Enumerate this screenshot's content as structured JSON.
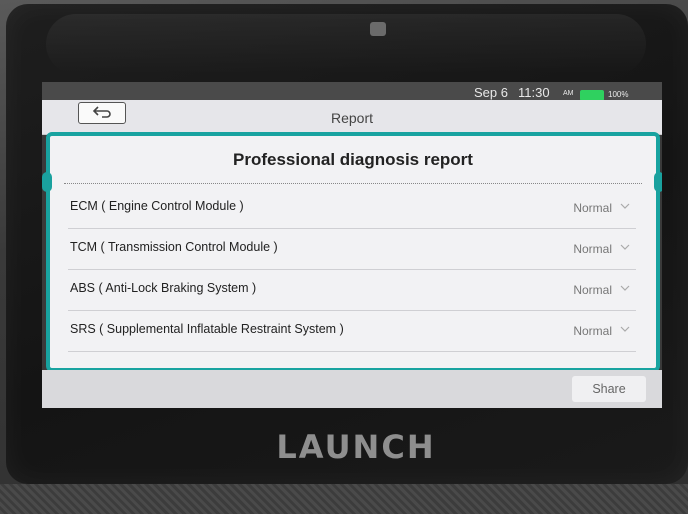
{
  "status_bar": {
    "date": "Sep 6",
    "time": "11:30",
    "ampm": "AM",
    "battery_pct": "100%",
    "battery_color": "#2fd15f"
  },
  "window": {
    "title": "Report",
    "back_icon": "back-arrow-icon"
  },
  "report": {
    "title": "Professional diagnosis report",
    "accent_color": "#18a3a0",
    "modules": [
      {
        "name": "ECM ( Engine Control Module )",
        "status": "Normal"
      },
      {
        "name": "TCM ( Transmission Control Module )",
        "status": "Normal"
      },
      {
        "name": "ABS ( Anti-Lock Braking System )",
        "status": "Normal"
      },
      {
        "name": "SRS ( Supplemental Inflatable Restraint System )",
        "status": "Normal"
      }
    ]
  },
  "toolbar": {
    "share_label": "Share"
  },
  "device": {
    "brand": "LAUNCH"
  }
}
